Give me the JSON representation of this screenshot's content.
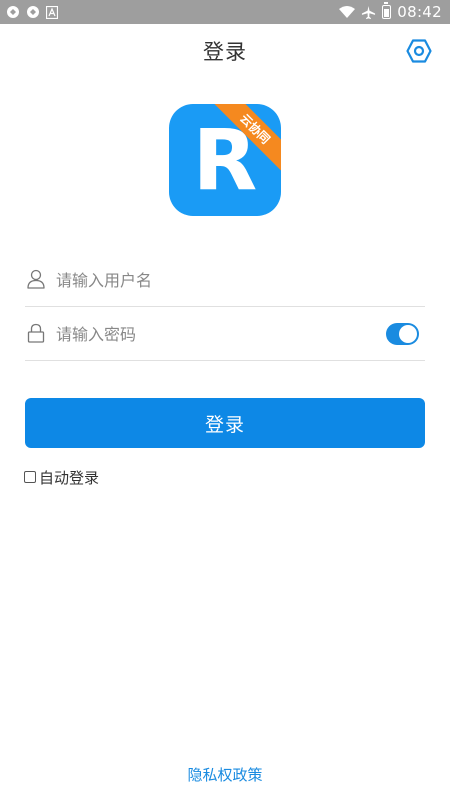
{
  "status_bar": {
    "time": "08:42",
    "icons_left": [
      "sync-icon",
      "sync-icon",
      "text-a-icon"
    ],
    "icons_right": [
      "wifi-icon",
      "airplane-icon",
      "battery-icon"
    ]
  },
  "header": {
    "title": "登录",
    "settings_icon": "settings-hex-icon"
  },
  "logo": {
    "letter": "R",
    "ribbon": "云协同",
    "background_color": "#1a9bf5",
    "ribbon_color": "#f5891f"
  },
  "form": {
    "username": {
      "placeholder": "请输入用户名",
      "value": "",
      "icon": "user-icon"
    },
    "password": {
      "placeholder": "请输入密码",
      "value": "",
      "icon": "lock-icon",
      "visibility_toggle_on": true
    },
    "submit_label": "登录",
    "auto_login": {
      "label": "自动登录",
      "checked": false
    }
  },
  "footer": {
    "privacy_label": "隐私权政策"
  },
  "colors": {
    "accent": "#0d88e6",
    "status_bar": "#9e9e9e",
    "link": "#1a8be0"
  }
}
